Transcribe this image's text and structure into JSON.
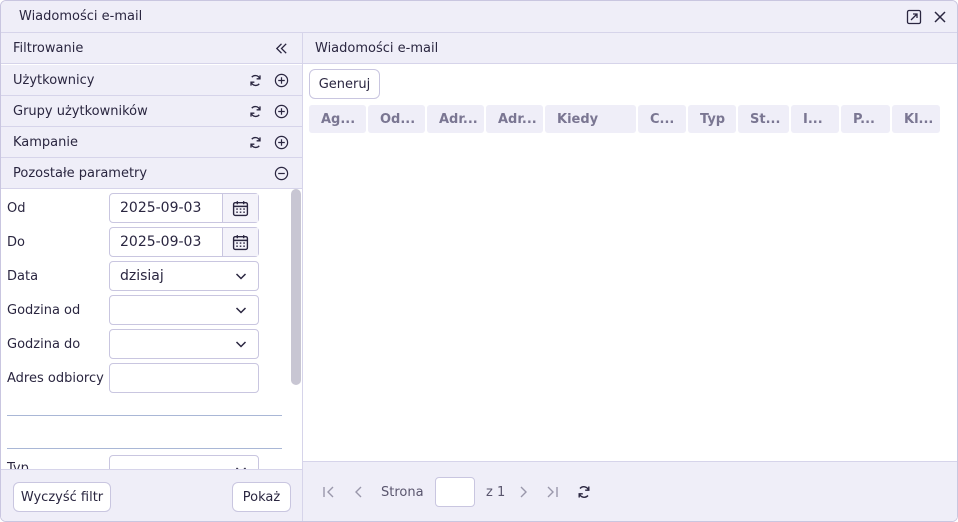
{
  "window": {
    "title": "Wiadomości e-mail"
  },
  "filter": {
    "title": "Filtrowanie",
    "sections": {
      "users": "Użytkownicy",
      "groups": "Grupy użytkowników",
      "campaigns": "Kampanie",
      "other": "Pozostałe parametry"
    },
    "params": {
      "from_label": "Od",
      "from_value": "2025-09-03",
      "to_label": "Do",
      "to_value": "2025-09-03",
      "date_label": "Data",
      "date_value": "dzisiaj",
      "hour_from_label": "Godzina od",
      "hour_to_label": "Godzina do",
      "recipient_label": "Adres odbiorcy",
      "type_label": "Typ"
    },
    "clear_label": "Wyczyść filtr",
    "show_label": "Pokaż"
  },
  "main": {
    "title": "Wiadomości e-mail",
    "generate_label": "Generuj",
    "columns": [
      "Ag...",
      "Od...",
      "Adr...",
      "Adr...",
      "Kiedy",
      "C...",
      "Typ",
      "St...",
      "I...",
      "P...",
      "Kl..."
    ]
  },
  "pager": {
    "page_label": "Strona",
    "of_label": "z 1"
  },
  "colors": {
    "header_bg": "#efeef8",
    "border": "#c9c6e0",
    "text": "#2a2640"
  }
}
